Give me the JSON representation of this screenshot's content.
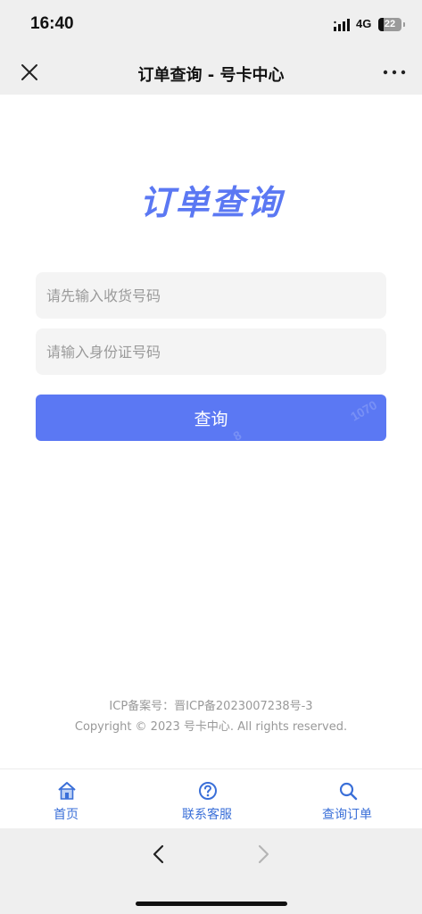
{
  "status_bar": {
    "time": "16:40",
    "network": "4G",
    "battery": "22",
    "battery_level": 0.22
  },
  "nav_bar": {
    "title": "订单查询 - 号卡中心",
    "close_icon": "close-icon",
    "more_icon": "more-dots-icon"
  },
  "page": {
    "heading": "订单查询",
    "order_placeholder": "请先输入收货号码",
    "order_value": "",
    "id_placeholder": "请输入身份证号码",
    "id_value": "",
    "query_button": "查询",
    "watermarks": [
      "1070",
      "8"
    ]
  },
  "footer": {
    "icp": "ICP备案号：晋ICP备2023007238号-3",
    "copyright": "Copyright © 2023 号卡中心. All rights reserved."
  },
  "tab_bar": {
    "items": [
      {
        "label": "首页",
        "icon": "home-icon"
      },
      {
        "label": "联系客服",
        "icon": "help-circle-icon"
      },
      {
        "label": "查询订单",
        "icon": "search-icon"
      }
    ]
  },
  "colors": {
    "accent": "#5b78f3",
    "tab_label": "#3a6fd8",
    "bar_background": "#efefef"
  }
}
